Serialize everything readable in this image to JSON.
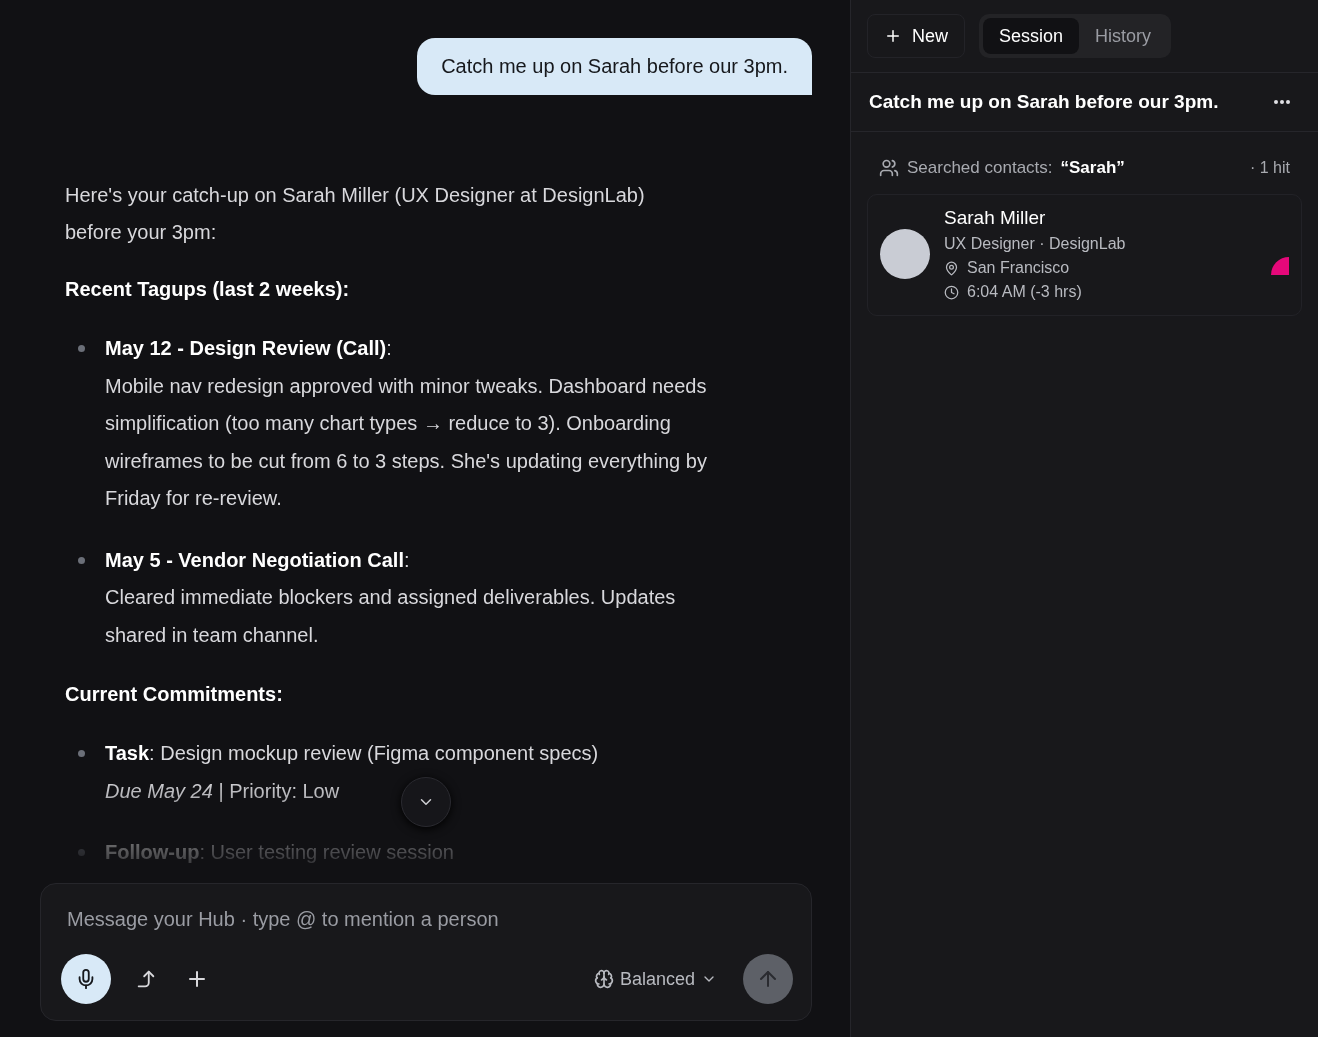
{
  "chat": {
    "user_message": "Catch me up on Sarah before our 3pm.",
    "blocks": [
      {
        "kind": "paragraph",
        "text": "Here's your catch-up on Sarah Miller (UX Designer at DesignLab) before your 3pm:"
      },
      {
        "kind": "heading",
        "text": "Recent Tagups (last 2 weeks):"
      },
      {
        "kind": "list",
        "items": [
          {
            "heading": "**May 12 - Design Review (Call)**:",
            "body": "Mobile nav redesign approved with minor tweaks. Dashboard needs simplification (too many chart types → reduce to 3). Onboarding wireframes to be cut from 6 to 3 steps. She's updating everything by Friday for re-review."
          },
          {
            "heading": "**May 5 - Vendor Negotiation Call**:",
            "body": "Cleared immediate blockers and assigned deliverables. Updates shared in team channel."
          }
        ]
      },
      {
        "kind": "heading",
        "text": "Current Commitments:"
      },
      {
        "kind": "list",
        "items": [
          {
            "heading": "**Task**: Design mockup review (Figma component specs)",
            "body": "*Due May 24* | Priority: Low"
          },
          {
            "heading": "**Follow-up**: User testing review session"
          }
        ]
      }
    ]
  },
  "composer": {
    "placeholder": "Message your Hub · type @ to mention a person",
    "mode": "Balanced"
  },
  "sidebar": {
    "new_button": "New",
    "tabs": [
      {
        "label": "Session",
        "selected": true
      },
      {
        "label": "History",
        "selected": false
      }
    ],
    "session_title": "Catch me up on Sarah before our 3pm.",
    "search": {
      "label": "Searched contacts:",
      "query": "“Sarah”",
      "hits": "· 1 hit"
    },
    "contact": {
      "name": "Sarah Miller",
      "role": "UX Designer · DesignLab",
      "location": "San Francisco",
      "time": "6:04 AM (-3 hrs)",
      "color": "#e5087a"
    }
  }
}
